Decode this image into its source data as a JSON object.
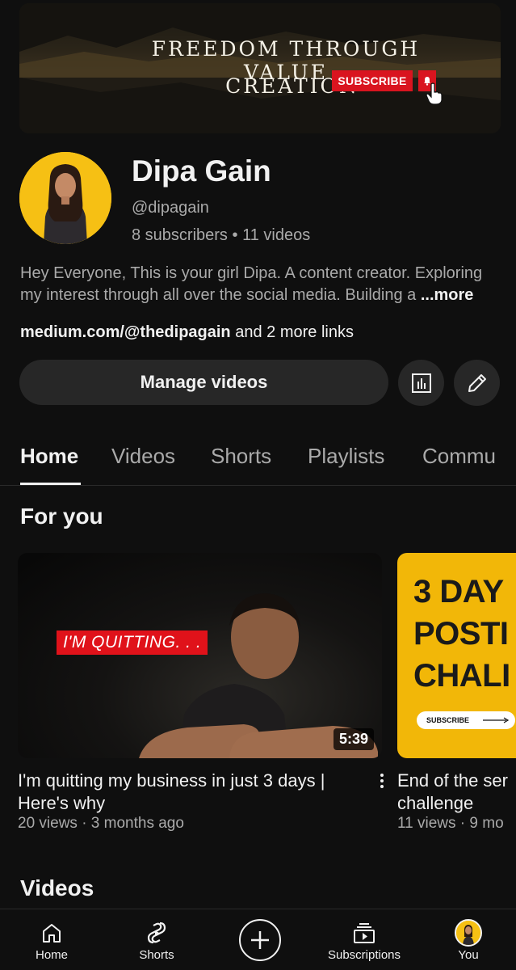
{
  "banner": {
    "line1": "Freedom through value",
    "line2": "creation",
    "subscribe_label": "SUBSCRIBE"
  },
  "channel": {
    "name": "Dipa Gain",
    "handle": "@dipagain",
    "subscribers": "8 subscribers",
    "videos": "11 videos",
    "stats_separator": "•",
    "description_line1": "Hey Everyone, This is your girl Dipa. A content creator. Exploring",
    "description_line2": "my interest through all over the social media. Building a",
    "description_more": "...more",
    "link": "medium.com/@thedipagain",
    "more_links": "and 2 more links"
  },
  "actions": {
    "manage_label": "Manage videos",
    "stats_icon": "analytics-icon",
    "edit_icon": "pencil-icon"
  },
  "tabs": [
    {
      "label": "Home",
      "active": true
    },
    {
      "label": "Videos",
      "active": false
    },
    {
      "label": "Shorts",
      "active": false
    },
    {
      "label": "Playlists",
      "active": false
    },
    {
      "label": "Commu",
      "active": false
    }
  ],
  "sections": {
    "for_you": "For you",
    "videos": "Videos"
  },
  "videos": [
    {
      "overlay_text": "I'M QUITTING. . .",
      "duration": "5:39",
      "title_line1": "I'm quitting my business in just 3 days |",
      "title_line2": "Here's why",
      "meta": "20 views · 3 months ago"
    },
    {
      "thumb_lines": [
        "3 DAY",
        "POSTI",
        "CHALI"
      ],
      "thumb_sub": "SUBSCRIBE",
      "title_line1": "End of the ser",
      "title_line2": "challenge",
      "meta": "11 views · 9 mo"
    }
  ],
  "nav": [
    {
      "label": "Home",
      "icon": "home-icon"
    },
    {
      "label": "Shorts",
      "icon": "shorts-icon"
    },
    {
      "label": "",
      "icon": "create-icon"
    },
    {
      "label": "Subscriptions",
      "icon": "subscriptions-icon"
    },
    {
      "label": "You",
      "icon": "avatar"
    }
  ],
  "colors": {
    "background": "#0f0f0f",
    "surface": "#272727",
    "text_primary": "#f1f1f1",
    "text_secondary": "#aaaaaa",
    "brand_red": "#d9141f",
    "avatar_yellow": "#f6c014"
  }
}
